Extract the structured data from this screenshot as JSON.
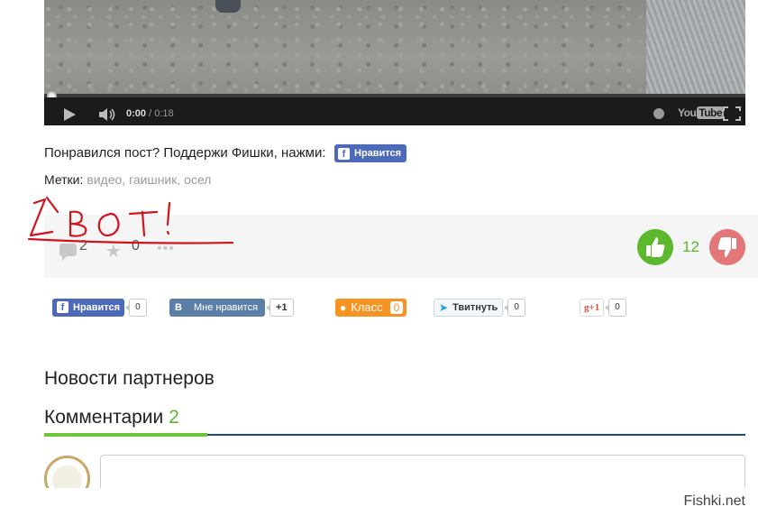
{
  "video": {
    "time_current": "0:00",
    "time_total": "/ 0:18",
    "youtube_label": "You",
    "youtube_tube": "Tube",
    "progress": 0
  },
  "like_prompt": {
    "text": "Понравился пост? Поддержи Фишки, нажми:",
    "button_icon": "f",
    "button_label": "Нравится"
  },
  "tags": {
    "label": "Метки:",
    "items": [
      "видео",
      "гаишник",
      "осел"
    ]
  },
  "stats": {
    "comments": "2",
    "favorites": "0",
    "more": "•••",
    "rating": "12"
  },
  "handwriting": {
    "text": "ВОТ!",
    "color": "#d0141d"
  },
  "share": {
    "facebook": {
      "icon": "f",
      "label": "Нравится",
      "count": "0"
    },
    "vkontakte": {
      "icon": "В",
      "label": "Мне нравится",
      "count": "+1"
    },
    "odnoklassniki": {
      "label": "Класс",
      "count": "0"
    },
    "twitter": {
      "icon": "🐦",
      "label": "Твитнуть",
      "count": "0"
    },
    "googleplus": {
      "label": "g+1",
      "count": "0"
    }
  },
  "partners": {
    "title": "Новости партнеров"
  },
  "comments": {
    "title": "Комментарии",
    "count": "2"
  },
  "watermark": "Fishki.net",
  "colors": {
    "accent_green": "#5cb82d",
    "dislike_red": "#e27679",
    "facebook_blue": "#4c69ba",
    "rule_blue": "#1f4d7a"
  }
}
